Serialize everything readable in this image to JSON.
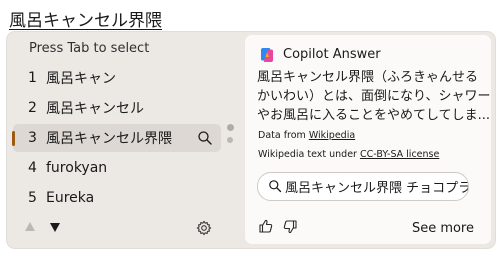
{
  "composition_text": "風呂キャンセル界隈",
  "candidates_panel": {
    "hint": "Press Tab to select",
    "candidates": [
      {
        "number": "1",
        "text": "風呂キャン"
      },
      {
        "number": "2",
        "text": "風呂キャンセル"
      },
      {
        "number": "3",
        "text": "風呂キャンセル界隈"
      },
      {
        "number": "4",
        "text": "furokyan"
      },
      {
        "number": "5",
        "text": "Eureka"
      }
    ],
    "selected_index": 3
  },
  "copilot": {
    "title": "Copilot Answer",
    "description_lines": [
      "風呂キャンセル界隈（ふろきゃんせる",
      "かいわい）とは、面倒になり、シャワー",
      "やお風呂に入ることをやめてしてしま..."
    ],
    "source_label": "Data from",
    "source_link": "Wikipedia",
    "license_label": "Wikipedia text under",
    "license_link": "CC-BY-SA license",
    "query": "風呂キャンセル界隈 チョコプラ",
    "see_more": "See more"
  },
  "colors": {
    "panel_bg": "#ece8e4",
    "selected_bg": "#ddd8d3",
    "selection_accent": "#9c5a12",
    "card_bg": "#fbfaf9"
  },
  "icons": [
    "search-icon",
    "settings-gear-icon",
    "page-up-icon",
    "page-down-icon",
    "copilot-logo-icon",
    "thumbs-up-icon",
    "thumbs-down-icon"
  ]
}
